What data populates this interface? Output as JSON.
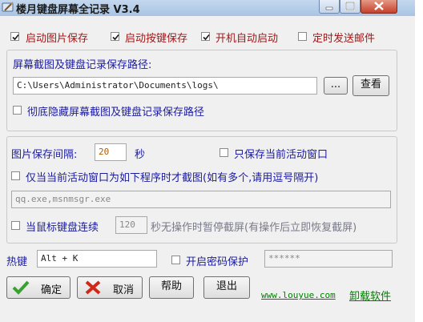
{
  "window": {
    "title": "楼月键盘屏幕全记录 V3.4",
    "colors": {
      "label": "#1b1ba0",
      "accent_red": "#a01818",
      "link": "#008000"
    }
  },
  "options": {
    "start_screenshot": {
      "label": "启动图片保存",
      "checked": true
    },
    "start_keylog": {
      "label": "启动按键保存",
      "checked": true
    },
    "autostart": {
      "label": "开机自动启动",
      "checked": true
    },
    "scheduled_email": {
      "label": "定时发送邮件",
      "checked": false
    }
  },
  "path_group": {
    "title": "屏幕截图及键盘记录保存路径:",
    "path_value": "C:\\Users\\Administrator\\Documents\\logs\\",
    "browse_label": "...",
    "view_label": "查看",
    "hide_label": "彻底隐藏屏幕截图及键盘记录保存路径",
    "hide_checked": false
  },
  "capture_group": {
    "interval_label": "图片保存间隔:",
    "interval_value": "20",
    "interval_unit": "秒",
    "only_active_label": "只保存当前活动窗口",
    "only_active_checked": false,
    "program_filter_label": "仅当当前活动窗口为如下程序时才截图(如有多个,请用逗号隔开)",
    "program_filter_checked": false,
    "program_list_value": "qq.exe,msnmsgr.exe",
    "idle_prefix": "当鼠标键盘连续",
    "idle_checked": false,
    "idle_value": "120",
    "idle_suffix": "秒无操作时暂停截屏(有操作后立即恢复截屏)"
  },
  "hotkey": {
    "label": "热键",
    "value": "Alt + K",
    "password_label": "开启密码保护",
    "password_checked": false,
    "password_value": "******"
  },
  "buttons": {
    "ok": "确定",
    "cancel": "取消",
    "help": "帮助",
    "exit": "退出"
  },
  "footer": {
    "website": "www.louyue.com",
    "uninstall": "卸载软件"
  }
}
